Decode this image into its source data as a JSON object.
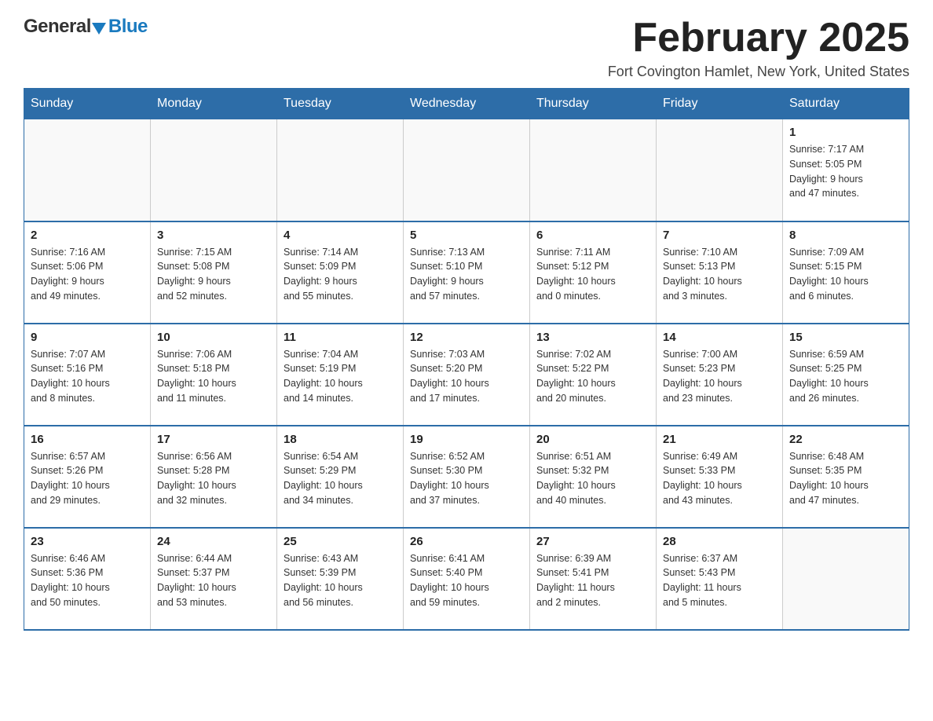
{
  "header": {
    "logo_general": "General",
    "logo_blue": "Blue",
    "title": "February 2025",
    "location": "Fort Covington Hamlet, New York, United States"
  },
  "days_of_week": [
    "Sunday",
    "Monday",
    "Tuesday",
    "Wednesday",
    "Thursday",
    "Friday",
    "Saturday"
  ],
  "weeks": [
    [
      {
        "day": "",
        "info": ""
      },
      {
        "day": "",
        "info": ""
      },
      {
        "day": "",
        "info": ""
      },
      {
        "day": "",
        "info": ""
      },
      {
        "day": "",
        "info": ""
      },
      {
        "day": "",
        "info": ""
      },
      {
        "day": "1",
        "info": "Sunrise: 7:17 AM\nSunset: 5:05 PM\nDaylight: 9 hours\nand 47 minutes."
      }
    ],
    [
      {
        "day": "2",
        "info": "Sunrise: 7:16 AM\nSunset: 5:06 PM\nDaylight: 9 hours\nand 49 minutes."
      },
      {
        "day": "3",
        "info": "Sunrise: 7:15 AM\nSunset: 5:08 PM\nDaylight: 9 hours\nand 52 minutes."
      },
      {
        "day": "4",
        "info": "Sunrise: 7:14 AM\nSunset: 5:09 PM\nDaylight: 9 hours\nand 55 minutes."
      },
      {
        "day": "5",
        "info": "Sunrise: 7:13 AM\nSunset: 5:10 PM\nDaylight: 9 hours\nand 57 minutes."
      },
      {
        "day": "6",
        "info": "Sunrise: 7:11 AM\nSunset: 5:12 PM\nDaylight: 10 hours\nand 0 minutes."
      },
      {
        "day": "7",
        "info": "Sunrise: 7:10 AM\nSunset: 5:13 PM\nDaylight: 10 hours\nand 3 minutes."
      },
      {
        "day": "8",
        "info": "Sunrise: 7:09 AM\nSunset: 5:15 PM\nDaylight: 10 hours\nand 6 minutes."
      }
    ],
    [
      {
        "day": "9",
        "info": "Sunrise: 7:07 AM\nSunset: 5:16 PM\nDaylight: 10 hours\nand 8 minutes."
      },
      {
        "day": "10",
        "info": "Sunrise: 7:06 AM\nSunset: 5:18 PM\nDaylight: 10 hours\nand 11 minutes."
      },
      {
        "day": "11",
        "info": "Sunrise: 7:04 AM\nSunset: 5:19 PM\nDaylight: 10 hours\nand 14 minutes."
      },
      {
        "day": "12",
        "info": "Sunrise: 7:03 AM\nSunset: 5:20 PM\nDaylight: 10 hours\nand 17 minutes."
      },
      {
        "day": "13",
        "info": "Sunrise: 7:02 AM\nSunset: 5:22 PM\nDaylight: 10 hours\nand 20 minutes."
      },
      {
        "day": "14",
        "info": "Sunrise: 7:00 AM\nSunset: 5:23 PM\nDaylight: 10 hours\nand 23 minutes."
      },
      {
        "day": "15",
        "info": "Sunrise: 6:59 AM\nSunset: 5:25 PM\nDaylight: 10 hours\nand 26 minutes."
      }
    ],
    [
      {
        "day": "16",
        "info": "Sunrise: 6:57 AM\nSunset: 5:26 PM\nDaylight: 10 hours\nand 29 minutes."
      },
      {
        "day": "17",
        "info": "Sunrise: 6:56 AM\nSunset: 5:28 PM\nDaylight: 10 hours\nand 32 minutes."
      },
      {
        "day": "18",
        "info": "Sunrise: 6:54 AM\nSunset: 5:29 PM\nDaylight: 10 hours\nand 34 minutes."
      },
      {
        "day": "19",
        "info": "Sunrise: 6:52 AM\nSunset: 5:30 PM\nDaylight: 10 hours\nand 37 minutes."
      },
      {
        "day": "20",
        "info": "Sunrise: 6:51 AM\nSunset: 5:32 PM\nDaylight: 10 hours\nand 40 minutes."
      },
      {
        "day": "21",
        "info": "Sunrise: 6:49 AM\nSunset: 5:33 PM\nDaylight: 10 hours\nand 43 minutes."
      },
      {
        "day": "22",
        "info": "Sunrise: 6:48 AM\nSunset: 5:35 PM\nDaylight: 10 hours\nand 47 minutes."
      }
    ],
    [
      {
        "day": "23",
        "info": "Sunrise: 6:46 AM\nSunset: 5:36 PM\nDaylight: 10 hours\nand 50 minutes."
      },
      {
        "day": "24",
        "info": "Sunrise: 6:44 AM\nSunset: 5:37 PM\nDaylight: 10 hours\nand 53 minutes."
      },
      {
        "day": "25",
        "info": "Sunrise: 6:43 AM\nSunset: 5:39 PM\nDaylight: 10 hours\nand 56 minutes."
      },
      {
        "day": "26",
        "info": "Sunrise: 6:41 AM\nSunset: 5:40 PM\nDaylight: 10 hours\nand 59 minutes."
      },
      {
        "day": "27",
        "info": "Sunrise: 6:39 AM\nSunset: 5:41 PM\nDaylight: 11 hours\nand 2 minutes."
      },
      {
        "day": "28",
        "info": "Sunrise: 6:37 AM\nSunset: 5:43 PM\nDaylight: 11 hours\nand 5 minutes."
      },
      {
        "day": "",
        "info": ""
      }
    ]
  ]
}
